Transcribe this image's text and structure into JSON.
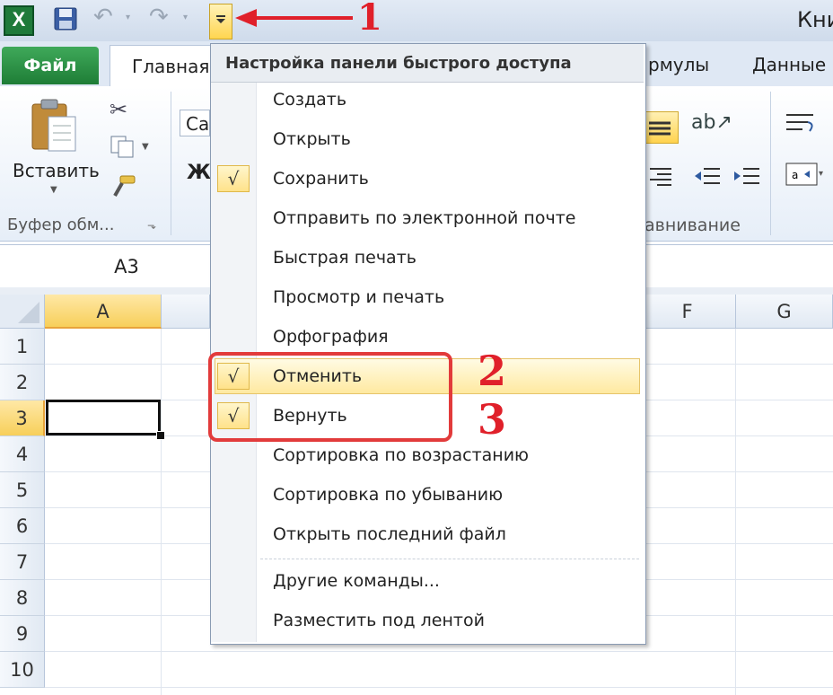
{
  "window": {
    "title": "Кни"
  },
  "title_bar": {
    "excel_icon": "X"
  },
  "tabs": {
    "file": "Файл",
    "home": "Главная",
    "formulas": "рмулы",
    "data": "Данные"
  },
  "ribbon": {
    "paste_label": "Вставить",
    "clipboard_group": "Буфер обм...",
    "font_box": "Ca",
    "bold_stub": "Ж",
    "alignment_group": "авнивание"
  },
  "name_box": "A3",
  "columns": [
    "A",
    "F",
    "G"
  ],
  "rows": [
    "1",
    "2",
    "3",
    "4",
    "5",
    "6",
    "7",
    "8",
    "9",
    "10"
  ],
  "menu": {
    "header": "Настройка панели быстрого доступа",
    "items": [
      {
        "label": "Создать",
        "checked": false
      },
      {
        "label": "Открыть",
        "checked": false
      },
      {
        "label": "Сохранить",
        "checked": true
      },
      {
        "label": "Отправить по электронной почте",
        "checked": false
      },
      {
        "label": "Быстрая печать",
        "checked": false
      },
      {
        "label": "Просмотр и печать",
        "checked": false
      },
      {
        "label": "Орфография",
        "checked": false
      },
      {
        "label": "Отменить",
        "checked": true
      },
      {
        "label": "Вернуть",
        "checked": true
      },
      {
        "label": "Сортировка по возрастанию",
        "checked": false
      },
      {
        "label": "Сортировка по убыванию",
        "checked": false
      },
      {
        "label": "Открыть последний файл",
        "checked": false
      }
    ],
    "footer_items": [
      "Другие команды...",
      "Разместить под лентой"
    ],
    "check_mark": "√"
  },
  "annotations": {
    "n1": "1",
    "n2": "2",
    "n3": "3",
    "color": "#e0202a"
  },
  "colors": {
    "file_tab": "#1e7d36",
    "highlight": "#ffd54f",
    "annotation": "#e23b3b"
  }
}
